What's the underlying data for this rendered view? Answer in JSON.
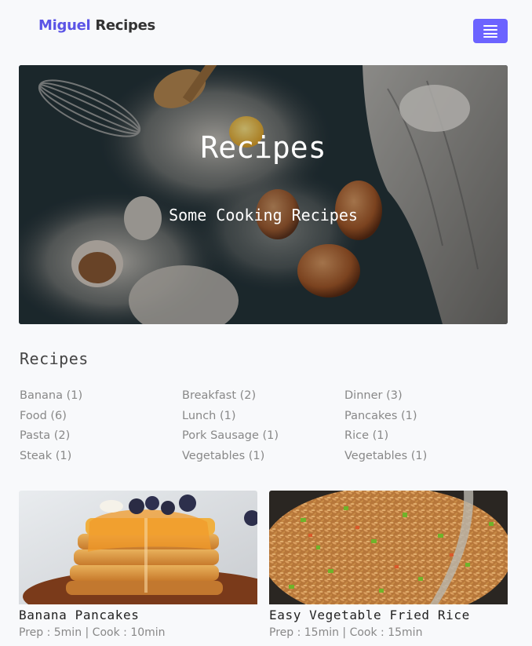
{
  "navbar": {
    "brand_first": "Miguel",
    "brand_second": "Recipes",
    "menu_icon": "hamburger-menu-icon",
    "accent_color": "#6c63ff"
  },
  "hero": {
    "title": "Recipes",
    "subtitle": "Some Cooking Recipes"
  },
  "categories": {
    "heading": "Recipes",
    "items": [
      {
        "label": "Banana (1)"
      },
      {
        "label": "Breakfast (2)"
      },
      {
        "label": "Dinner (3)"
      },
      {
        "label": "Food (6)"
      },
      {
        "label": "Lunch (1)"
      },
      {
        "label": "Pancakes (1)"
      },
      {
        "label": "Pasta (2)"
      },
      {
        "label": "Pork Sausage (1)"
      },
      {
        "label": "Rice (1)"
      },
      {
        "label": "Steak (1)"
      },
      {
        "label": "Vegetables (1)"
      },
      {
        "label": "Vegetables (1)"
      }
    ]
  },
  "cards": [
    {
      "title": "Banana Pancakes",
      "meta": "Prep : 5min | Cook : 10min"
    },
    {
      "title": "Easy Vegetable Fried Rice",
      "meta": "Prep : 15min | Cook : 15min"
    }
  ]
}
